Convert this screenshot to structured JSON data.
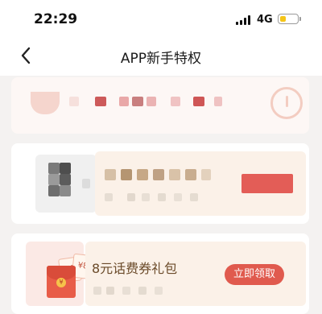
{
  "status_bar": {
    "time": "22:29",
    "network": "4G",
    "battery_level": 0.25,
    "battery_color": "#f5c518"
  },
  "nav": {
    "title": "APP新手特权",
    "back_icon": "chevron-left-icon"
  },
  "privilege_card": {
    "prize_name": "8元话费券礼包",
    "claim_label": "立即领取",
    "ticket_labels": [
      "¥8",
      "¥8"
    ],
    "coin_label": "¥",
    "accent_color": "#e05a4e"
  },
  "colors": {
    "page_bg": "#f4f2f1",
    "card_cream": "#fbf1e8",
    "button_red": "#e05a4e"
  }
}
